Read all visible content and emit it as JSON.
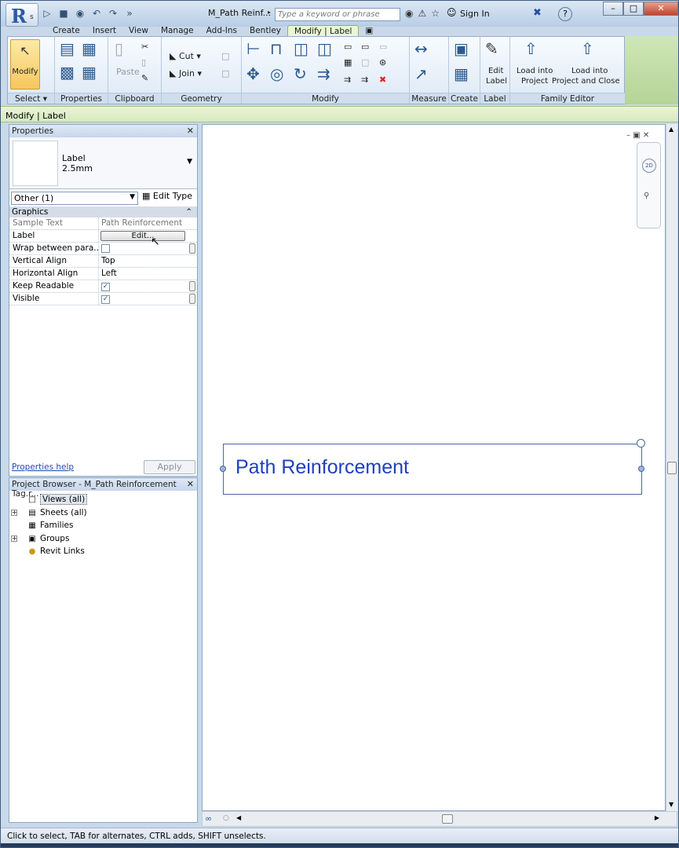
{
  "titlebar": {
    "doc_title": "M_Path Reinf...",
    "search_placeholder": "Type a keyword or phrase",
    "sign_in": "Sign In",
    "help": "?",
    "app_version": "s"
  },
  "tabs": [
    "Create",
    "Insert",
    "View",
    "Manage",
    "Add-Ins",
    "Bentley",
    "Modify | Label"
  ],
  "active_tab": "Modify | Label",
  "ribbon": {
    "modify_label": "Modify",
    "paste_label": "Paste",
    "cut_label": "Cut",
    "join_label": "Join",
    "edit_label_1": "Edit",
    "edit_label_2": "Label",
    "load_project_1": "Load into",
    "load_project_2": "Project",
    "load_close_1": "Load into",
    "load_close_2": "Project and Close",
    "panels": {
      "select": "Select",
      "properties": "Properties",
      "clipboard": "Clipboard",
      "geometry": "Geometry",
      "modify": "Modify",
      "measure": "Measure",
      "create": "Create",
      "label": "Label",
      "family_editor": "Family Editor"
    }
  },
  "options_bar": "Modify | Label",
  "properties": {
    "title": "Properties",
    "type_name": "Label",
    "type_size": "2.5mm",
    "filter": "Other (1)",
    "edit_type": "Edit Type",
    "group": "Graphics",
    "rows": {
      "sample_text_key": "Sample Text",
      "sample_text_val": "Path Reinforcement",
      "label_key": "Label",
      "label_btn": "Edit...",
      "wrap_key": "Wrap between para...",
      "valign_key": "Vertical Align",
      "valign_val": "Top",
      "halign_key": "Horizontal Align",
      "halign_val": "Left",
      "keep_key": "Keep Readable",
      "visible_key": "Visible"
    },
    "help_link": "Properties help",
    "apply": "Apply"
  },
  "browser": {
    "title": "Project Browser - M_Path Reinforcement Tag.r...",
    "items": [
      "Views (all)",
      "Sheets (all)",
      "Families",
      "Groups",
      "Revit Links"
    ]
  },
  "canvas": {
    "label_text": "Path Reinforcement",
    "navbar_wheel": "2D"
  },
  "status": "Click to select, TAB for alternates, CTRL adds, SHIFT unselects."
}
